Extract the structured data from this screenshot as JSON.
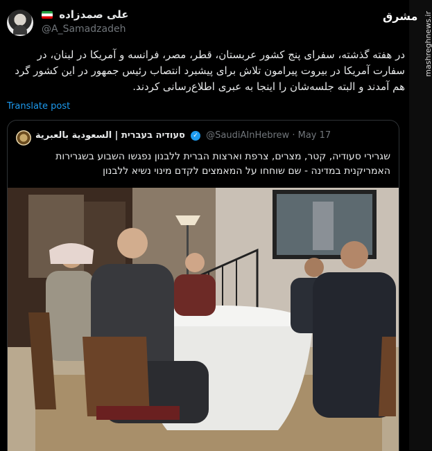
{
  "author": {
    "name": "علی صمدزاده",
    "handle": "@A_Samadzadeh",
    "flag": "iran-flag-icon"
  },
  "tweet": {
    "text": "در هفته گذشته، سفرای پنج کشور عربستان، قطر، مصر، فرانسه و آمریکا در لبنان، در سفارت آمریکا در بیروت پیرامون تلاش برای پیشبرد انتصاب رئیس جمهور در این کشور گرد هم آمدند و البته جلسه‌شان را اینجا به عبری اطلاع‌رسانی کردند.",
    "translate_label": "Translate post"
  },
  "quote": {
    "name": "סעודיה בעברית | السعودية بالعبرية",
    "handle": "@SaudiAInHebrew",
    "date": "May 17",
    "separator": "·",
    "text": "שגרירי סעודיה, קטר, מצרים, צרפת וארצות הברית ללבנון נפגשו השבוע בשגרירות האמריקנית במדינה - שם שוחחו על המאמצים לקדם מינוי נשיא ללבנון"
  },
  "watermark": {
    "logo": "مشرق",
    "url": "mashreghnews.ir"
  },
  "colors": {
    "background": "#000000",
    "text": "#e7e9ea",
    "muted": "#71767b",
    "link": "#1d9bf0",
    "border": "#2f3336"
  }
}
